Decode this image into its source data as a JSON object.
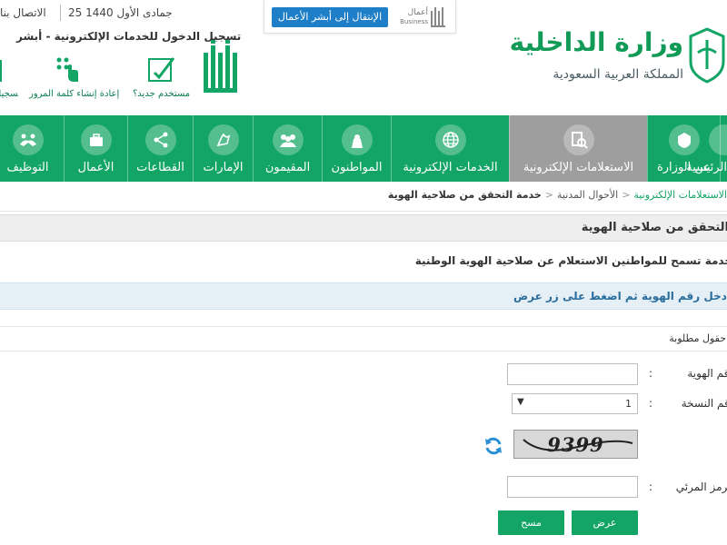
{
  "topbar": {
    "contact": "الاتصال بنا",
    "date": "25 جمادى الأول 1440"
  },
  "business": {
    "button": "الإنتقال إلى أبشر الأعمال",
    "logo_text": "أعمال",
    "logo_sub": "Business"
  },
  "login": {
    "title": "تسجيل الدخول للخدمات الإلكترونية - أبشر",
    "services": [
      {
        "label": "مستخدم جديد؟",
        "icon": "new-user-icon"
      },
      {
        "label": "إعادة إنشاء كلمة المرور",
        "icon": "reset-password-icon"
      },
      {
        "label": "تسجيل",
        "icon": "register-icon"
      }
    ]
  },
  "ministry": {
    "name": "وزارة الداخلية",
    "subtitle": "المملكة العربية السعودية"
  },
  "nav": [
    {
      "label": "الرئيسية",
      "icon": "home-icon"
    },
    {
      "label": "عن الوزارة",
      "icon": "emblem-icon"
    },
    {
      "label": "الاستعلامات الإلكترونية",
      "icon": "inquiries-icon",
      "active": true
    },
    {
      "label": "الخدمات الإلكترونية",
      "icon": "globe-icon"
    },
    {
      "label": "المواطنون",
      "icon": "citizen-icon"
    },
    {
      "label": "المقيمون",
      "icon": "residents-icon"
    },
    {
      "label": "الإمارات",
      "icon": "emirates-icon"
    },
    {
      "label": "القطاعات",
      "icon": "sectors-icon"
    },
    {
      "label": "الأعمال",
      "icon": "business-icon"
    },
    {
      "label": "التوظيف",
      "icon": "employment-icon"
    }
  ],
  "breadcrumb": [
    {
      "label": "الاستعلامات الإلكترونية"
    },
    {
      "label": "الأحوال المدنية"
    },
    {
      "label": "خدمة التحقق من صلاحية الهوية",
      "current": true
    }
  ],
  "page": {
    "title": "التحقق من صلاحية الهوية",
    "description": "خدمة تسمح للمواطنين الاستعلام عن صلاحية الهوية الوطنية",
    "instruction": "أدخل رقم الهوية ثم اضغط على زر عرض",
    "required_note": "* حقول مطلوبة"
  },
  "form": {
    "id_label": "رقم الهوية",
    "version_label": "رقم النسخة",
    "version_value": "1",
    "captcha_code": "9399",
    "visual_code_label": "الرمز المرئي",
    "submit": "عرض",
    "clear": "مسح"
  },
  "colors": {
    "primary_green": "#12a565",
    "active_gray": "#9e9e9e",
    "info_blue": "#2a6d9c",
    "link_blue": "#1e7ec8"
  }
}
